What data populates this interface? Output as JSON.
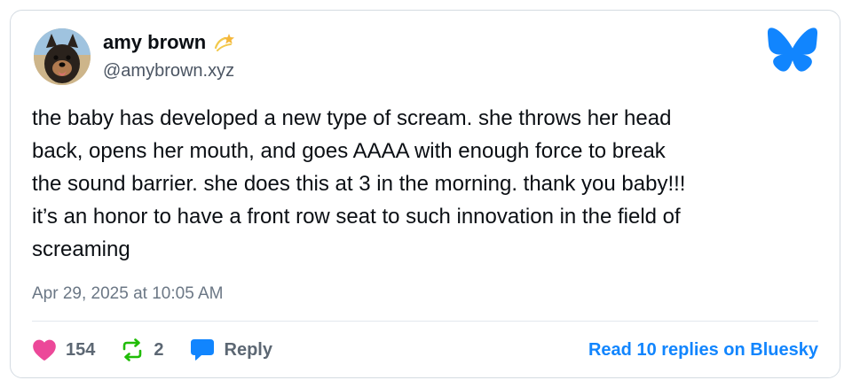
{
  "author": {
    "display_name": "amy brown",
    "name_emoji": "dizzy-star-icon",
    "handle": "@amybrown.xyz",
    "avatar": "dog-avatar"
  },
  "post": {
    "text": "the baby has developed a new type of scream. she throws her head\nback, opens her mouth, and goes AAAA with enough force to break\nthe sound barrier. she does this at 3 in the morning. thank you baby!!!\nit’s an honor to have a front row seat to such innovation in the field of\nscreaming",
    "timestamp": "Apr 29, 2025 at 10:05 AM"
  },
  "actions": {
    "likes": "154",
    "reposts": "2",
    "reply_label": "Reply",
    "read_replies_label": "Read 10 replies on Bluesky"
  },
  "icons": {
    "brand": "bluesky-butterfly-icon",
    "like": "heart-icon",
    "repost": "repost-icon",
    "reply": "speech-bubble-icon"
  },
  "colors": {
    "brand_blue": "#1185fe",
    "like_pink": "#ec4899",
    "repost_green": "#20bc07",
    "text": "#0b0f14",
    "muted": "#6b7785"
  }
}
